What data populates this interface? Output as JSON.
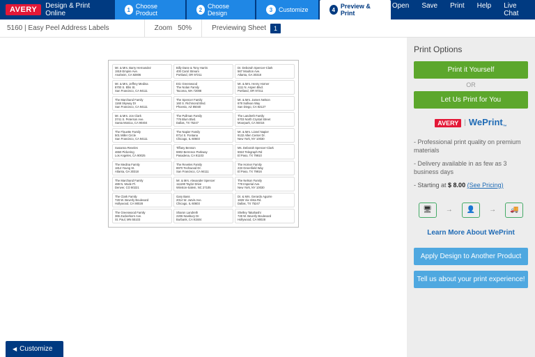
{
  "brand": "AVERY",
  "brand_sub": "Design & Print Online",
  "steps": [
    {
      "n": "1",
      "label": "Choose Product"
    },
    {
      "n": "2",
      "label": "Choose Design"
    },
    {
      "n": "3",
      "label": "Customize"
    },
    {
      "n": "4",
      "label": "Preview & Print"
    }
  ],
  "toplinks": [
    "Open",
    "Save",
    "Print",
    "Help",
    "Live Chat"
  ],
  "product": "5160 | Easy Peel Address Labels",
  "zoom_label": "Zoom",
  "zoom_value": "50%",
  "preview_label": "Previewing Sheet",
  "sheet_num": "1",
  "sidebar": {
    "title": "Print Options",
    "print_yourself": "Print it Yourself",
    "or": "OR",
    "let_us": "Let Us Print for You",
    "weprint_av": "AVERY",
    "weprint_wp": "WePrint",
    "info1": "- Professional print quality on premium materials",
    "info2": "- Delivery available in as few as 3 business days",
    "pricing_prefix": "- Starting at",
    "pricing_amount": "$ 8.00",
    "pricing_link": "(See Pricing)",
    "learn_more": "Learn More About WePrint",
    "apply_design": "Apply Design to Another Product",
    "tell_us": "Tell us about your print experience!"
  },
  "back": "Customize",
  "labels": [
    [
      "Mr. & Mrs. Barry Hernandez",
      "1919 Empire Ave.",
      "Anaheim, CA 92806"
    ],
    [
      "Billy Dane & Tony Harris",
      "400 Carol Stream",
      "Portland, OR 97211"
    ],
    [
      "Dr. Deborah Spencer-Clark",
      "567 Moulton Ave.",
      "Atlanta, GA 30318"
    ],
    [
      "Mr. & Mrs. Jeffrey Medina",
      "8700 S. Ellis St.",
      "San Francisco, CA 94111"
    ],
    [
      "Eric Greenwood",
      "The Nolan Family",
      "Tacoma, WA 72088"
    ],
    [
      "Mr. & Mrs. Henry Horner",
      "1111 N. Aspen Blvd.",
      "Portland, OR 97211"
    ],
    [
      "The Marchand Family",
      "1168 Skyway Dr",
      "San Francisco, CA 94111"
    ],
    [
      "The Spencer Family",
      "160 S. Richmond Blvd.",
      "Phoenix, AZ 85040"
    ],
    [
      "Mr. & Mrs. James Nelson",
      "678 Sullivan Way",
      "San Diego, CA 92127"
    ],
    [
      "Mr. & Mrs. Jon Clark",
      "3741 S. Peterson Ave.",
      "Santa Monica, CA 90404"
    ],
    [
      "The Pullman Family",
      "776 Blum Blvd.",
      "Dallas, TX 75247"
    ],
    [
      "The Landreth Family",
      "6703 North Crystal Street",
      "Moorpark, CA 94016"
    ],
    [
      "The Flouette Family",
      "501 Miller Circle",
      "San Francisco, CA 94111"
    ],
    [
      "The Napier Family",
      "8714 S. Fontana",
      "Chicago, IL 60603"
    ],
    [
      "Mr. & Mrs. Lionel Napier",
      "9132 Allen Center Dr.",
      "New York, NY 10030"
    ],
    [
      "Susanna Reveles",
      "4650 Pickering",
      "Los Angeles, CA 90025"
    ],
    [
      "Tiffany Benson",
      "5902 Berrence Parkway",
      "Pasadena, CA 91103"
    ],
    [
      "Ms. Deborah Spencer-Clark",
      "5910 Telegraph Rd",
      "El Paso, TX 79910"
    ],
    [
      "The Medina Family",
      "1814 Young St.",
      "Atlanta, GA 30318"
    ],
    [
      "The Reveles Family",
      "8970 Techwood Dr.",
      "San Francisco, CA 94111"
    ],
    [
      "The Horner Family",
      "233 Greenfield Way",
      "El Paso, TX 79916"
    ],
    [
      "The Marchand Family",
      "489 N. Mode Pl.",
      "Denver, CO 80221"
    ],
    [
      "Mr. & Mrs. Alexander Spencer",
      "111190 Taylor Drive",
      "Winston-Salem, NC 27105"
    ],
    [
      "The Nelson Family",
      "778 Imperial Ave.",
      "New York, NY 10030"
    ],
    [
      "The Clark Family",
      "728 W. Beverly Boulevard",
      "Hollywood, CA 90028"
    ],
    [
      "Gary Bass",
      "2014 W. Jarvis Ave.",
      "Chicago, IL 60603"
    ],
    [
      "Dr. & Mrs. Gerardo Aguirre",
      "1826 Via Vista Rd.",
      "Dallas, TX 75247"
    ],
    [
      "The Greenwood Family",
      "365 Zuckerkorn Ave.",
      "St. Paul, MN 55103"
    ],
    [
      "Sharon Landreth",
      "2206 Newbury Dr.",
      "Burbank, CA 91504"
    ],
    [
      "Shelley Takahashi",
      "728 W. Beverly Boulevard",
      "Hollywood, CA 90028"
    ]
  ]
}
